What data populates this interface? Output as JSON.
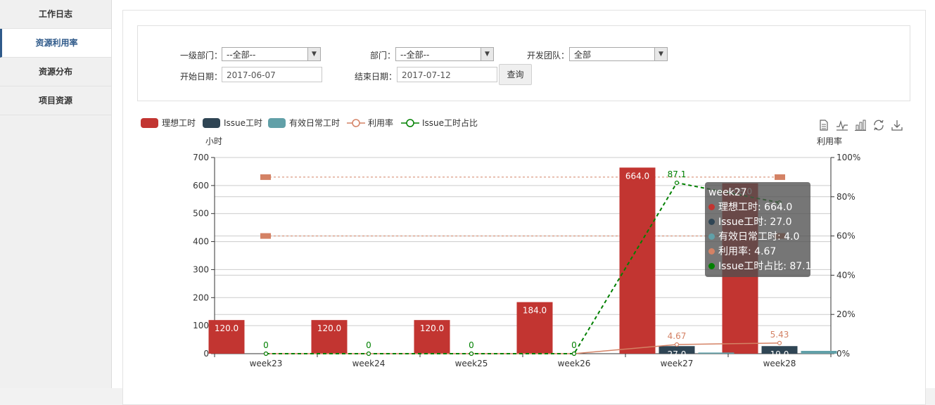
{
  "sidebar": {
    "items": [
      {
        "label": "工作日志",
        "active": false
      },
      {
        "label": "资源利用率",
        "active": true
      },
      {
        "label": "资源分布",
        "active": false
      },
      {
        "label": "项目资源",
        "active": false
      }
    ]
  },
  "filters": {
    "dept_level1_label": "一级部门：",
    "dept_level1_value": "--全部--",
    "dept_label": "部门：",
    "dept_value": "--全部--",
    "dev_team_label": "开发团队：",
    "dev_team_value": "全部",
    "start_date_label": "开始日期：",
    "start_date_value": "2017-06-07",
    "end_date_label": "结束日期：",
    "end_date_value": "2017-07-12",
    "query_label": "查询"
  },
  "colors": {
    "ideal": "#c23531",
    "issue": "#2f4554",
    "effective": "#61a0a8",
    "utilization": "#d48265",
    "issue_ratio": "#008000",
    "accent": "#2f5a8a"
  },
  "chart_data": {
    "type": "bar",
    "categories": [
      "week23",
      "week24",
      "week25",
      "week26",
      "week27",
      "week28"
    ],
    "ylabel": "小时",
    "ylabel_right": "利用率",
    "ylim": [
      0,
      700
    ],
    "yticks": [
      0,
      100,
      200,
      300,
      400,
      500,
      600,
      700
    ],
    "ylim_right": [
      0,
      100
    ],
    "yticks_right": [
      "0%",
      "20%",
      "40%",
      "60%",
      "80%",
      "100%"
    ],
    "grid": true,
    "legend_position": "top-left",
    "series": [
      {
        "name": "理想工时",
        "type": "bar",
        "values": [
          120.0,
          120.0,
          120.0,
          184.0,
          664.0,
          608.0
        ],
        "labels": [
          "120.0",
          "120.0",
          "120.0",
          "184.0",
          "664.0",
          "608.0"
        ]
      },
      {
        "name": "Issue工时",
        "type": "bar",
        "values": [
          0,
          0,
          0,
          0,
          27.0,
          27.0
        ],
        "labels": [
          "",
          "",
          "",
          "",
          "27.0",
          "19.0"
        ]
      },
      {
        "name": "有效日常工时",
        "type": "bar",
        "values": [
          0,
          0,
          0,
          0,
          4.0,
          10.0
        ],
        "labels": [
          "",
          "",
          "",
          "",
          "",
          ""
        ]
      },
      {
        "name": "利用率",
        "type": "line",
        "axis": "right",
        "values": [
          0,
          0,
          0,
          0,
          4.67,
          5.43
        ],
        "labels": [
          "",
          "",
          "",
          "",
          "4.67",
          "5.43"
        ]
      },
      {
        "name": "Issue工时占比",
        "type": "line",
        "axis": "right",
        "dashed": true,
        "values": [
          0,
          0,
          0,
          0,
          87.1,
          77.0
        ],
        "labels": [
          "0",
          "0",
          "0",
          "0",
          "87.1",
          ""
        ]
      }
    ],
    "mark_lines": [
      {
        "value": 90,
        "axis": "right"
      },
      {
        "value": 60,
        "axis": "right"
      }
    ]
  },
  "tooltip": {
    "title": "week27",
    "rows": [
      {
        "text": "理想工时: 664.0",
        "color": "#c23531"
      },
      {
        "text": "Issue工时: 27.0",
        "color": "#2f4554"
      },
      {
        "text": "有效日常工时: 4.0",
        "color": "#61a0a8"
      },
      {
        "text": "利用率: 4.67",
        "color": "#d48265"
      },
      {
        "text": "Issue工时占比: 87.1",
        "color": "#008000"
      }
    ]
  },
  "toolbox": [
    "data-view-icon",
    "line-chart-icon",
    "bar-chart-icon",
    "restore-icon",
    "save-image-icon"
  ]
}
